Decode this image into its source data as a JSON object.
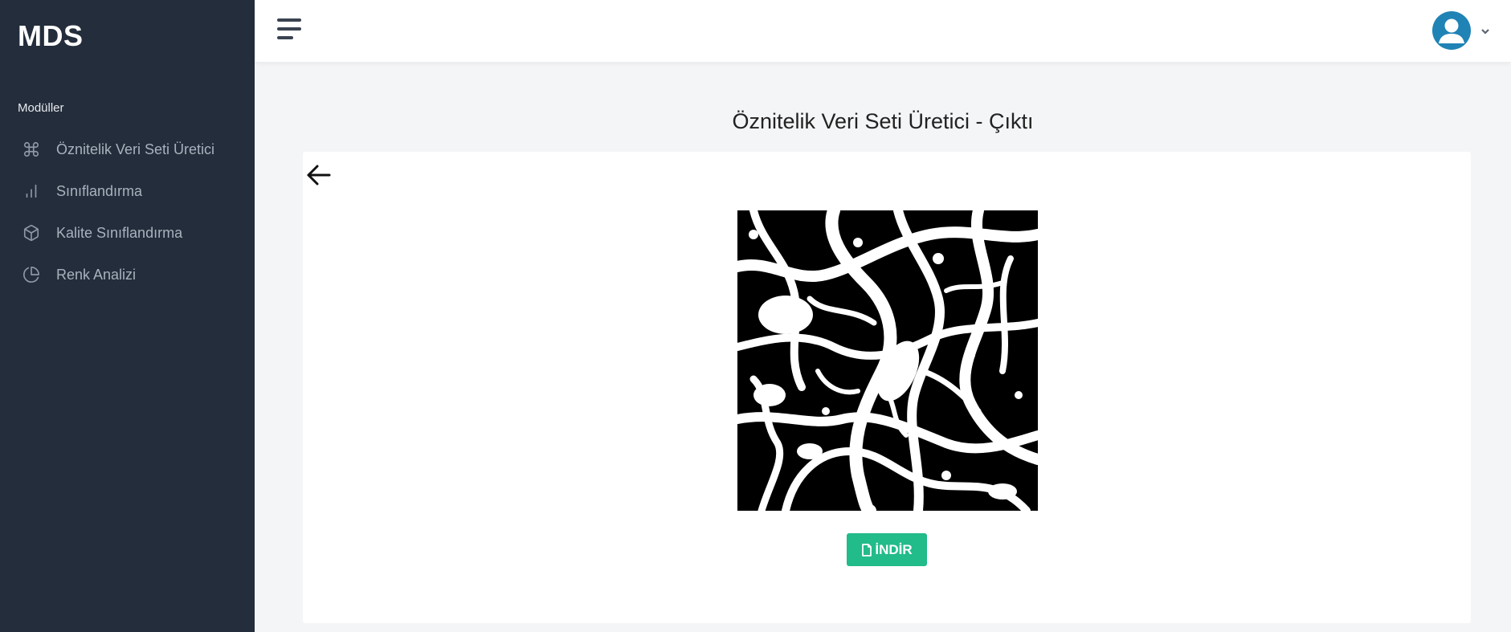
{
  "sidebar": {
    "brand": "MDS",
    "section_label": "Modüller",
    "items": [
      {
        "label": "Öznitelik Veri Seti Üretici",
        "icon": "command-icon"
      },
      {
        "label": "Sınıflandırma",
        "icon": "bar-chart-icon"
      },
      {
        "label": "Kalite Sınıflandırma",
        "icon": "box-icon"
      },
      {
        "label": "Renk Analizi",
        "icon": "pie-chart-icon"
      }
    ]
  },
  "header": {
    "menu_icon": "hamburger-icon",
    "user_icon": "user-avatar-icon",
    "dropdown_icon": "chevron-down-icon"
  },
  "main": {
    "title": "Öznitelik Veri Seti Üretici - Çıktı",
    "back_icon": "arrow-left-icon",
    "download_label": "İNDİR",
    "download_icon": "file-icon"
  },
  "colors": {
    "sidebar_bg": "#232d3b",
    "accent_green": "#22bb8a",
    "avatar_blue": "#1f83b5"
  }
}
